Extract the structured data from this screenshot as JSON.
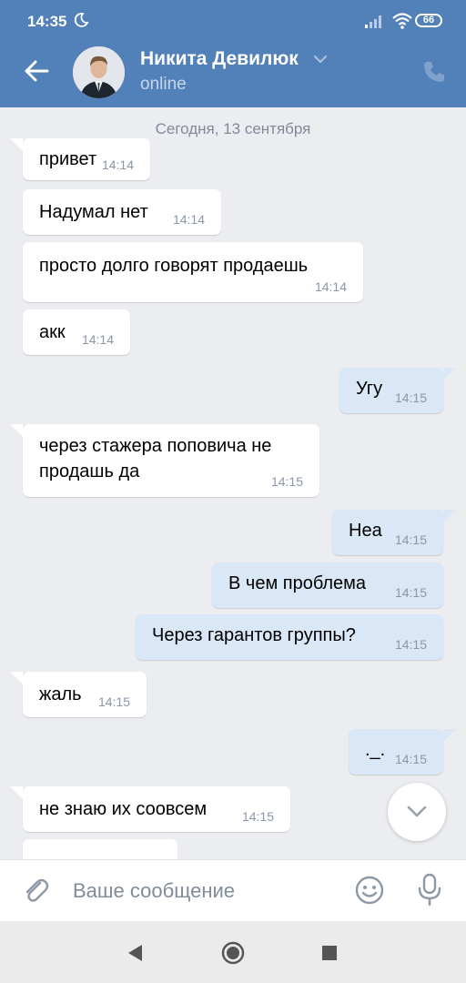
{
  "status_bar": {
    "time": "14:35",
    "battery": "66",
    "icons": [
      "moon-icon",
      "signal-icon",
      "wifi-icon",
      "battery-icon"
    ]
  },
  "header": {
    "contact_name": "Никита Девилюк",
    "status": "online",
    "icons": [
      "back-arrow-icon",
      "chevron-down-icon",
      "phone-icon"
    ]
  },
  "chat": {
    "date_separator": "Сегодня, 13 сентября",
    "messages": [
      {
        "dir": "in",
        "text": "привет",
        "time": "14:14"
      },
      {
        "dir": "in",
        "text": "Надумал нет",
        "time": "14:14"
      },
      {
        "dir": "in",
        "text": "просто долго говорят продаешь",
        "time": "14:14"
      },
      {
        "dir": "in",
        "text": "акк",
        "time": "14:14"
      },
      {
        "dir": "out",
        "text": "Угу",
        "time": "14:15"
      },
      {
        "dir": "in",
        "text": "через стажера поповича не продашь да",
        "time": "14:15"
      },
      {
        "dir": "out",
        "text": "Неа",
        "time": "14:15"
      },
      {
        "dir": "out",
        "text": "В чем проблема",
        "time": "14:15"
      },
      {
        "dir": "out",
        "text": "Через гарантов группы?",
        "time": "14:15"
      },
      {
        "dir": "in",
        "text": "жаль",
        "time": "14:15"
      },
      {
        "dir": "out",
        "text": "._.",
        "time": "14:15"
      },
      {
        "dir": "in",
        "text": "не знаю их соовсем",
        "time": "14:15"
      }
    ]
  },
  "composer": {
    "placeholder": "Ваше сообщение",
    "icons": [
      "paperclip-icon",
      "sticker-icon",
      "microphone-icon"
    ]
  },
  "colors": {
    "header_bg": "#5181b8",
    "chat_bg": "#ebedf0",
    "incoming_bubble": "#ffffff",
    "outgoing_bubble": "#dae7f6",
    "time_text": "#8a97a8"
  }
}
